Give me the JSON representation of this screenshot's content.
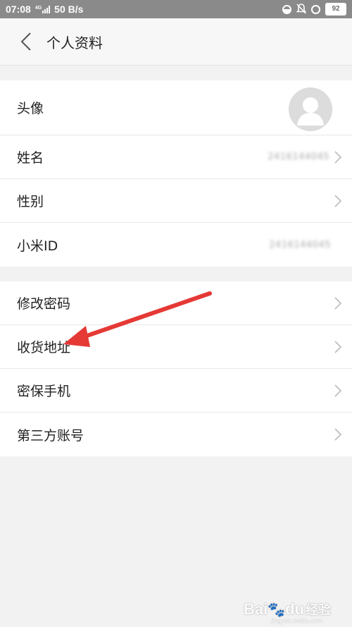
{
  "status_bar": {
    "time": "07:08",
    "network": "4G",
    "speed": "50 B/s",
    "battery": "92"
  },
  "header": {
    "title": "个人资料",
    "back_icon": "chevron-left-icon"
  },
  "profile_group": [
    {
      "label": "头像",
      "type": "avatar"
    },
    {
      "label": "姓名",
      "value": "2416144045",
      "arrow": true
    },
    {
      "label": "性别",
      "value": "",
      "arrow": true
    },
    {
      "label": "小米ID",
      "value": "2416144045",
      "arrow": false
    }
  ],
  "security_group": [
    {
      "label": "修改密码",
      "arrow": true
    },
    {
      "label": "收货地址",
      "arrow": true
    },
    {
      "label": "密保手机",
      "arrow": true
    },
    {
      "label": "第三方账号",
      "arrow": true
    }
  ],
  "annotation": {
    "arrow_color": "#e53935",
    "target": "收货地址"
  },
  "watermark": {
    "brand": "Bai",
    "brand_tail": "du",
    "suffix": "经验",
    "url": "jingyan.baidu.com"
  }
}
